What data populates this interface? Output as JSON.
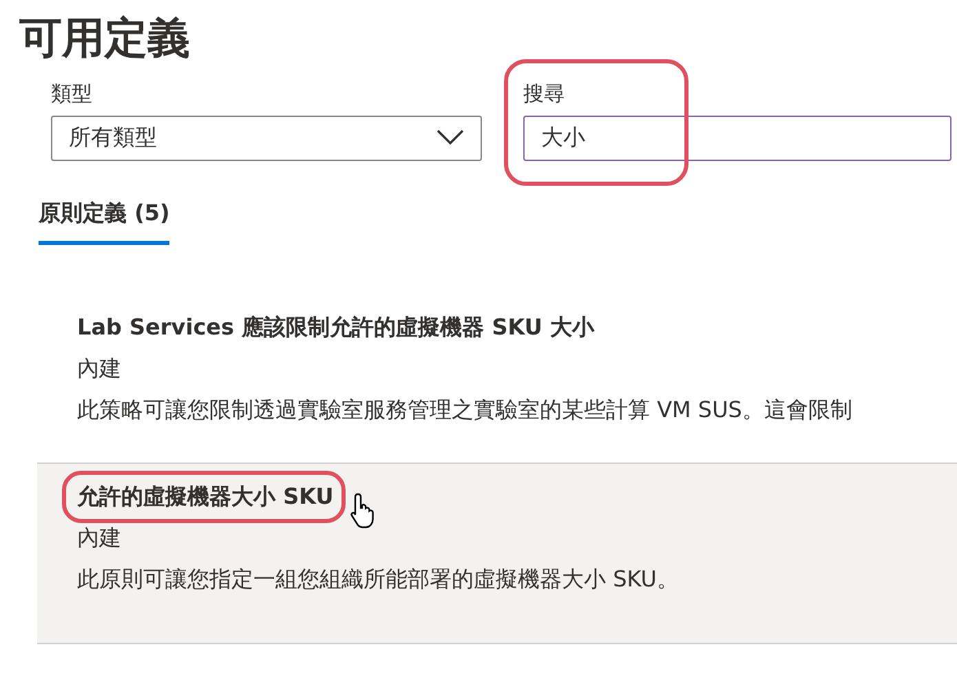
{
  "title": "可用定義",
  "filters": [
    {
      "kind": "dropdown",
      "label": "類型",
      "value": "所有類型",
      "highlighted": false
    },
    {
      "kind": "text",
      "label": "搜尋",
      "value": "大小",
      "highlighted": true
    }
  ],
  "tabs": [
    {
      "label": "原則定義 (5)",
      "selected": true
    }
  ],
  "definitions": [
    {
      "title": "Lab Services 應該限制允許的虛擬機器 SKU 大小",
      "type": "內建",
      "description": "此策略可讓您限制透過實驗室服務管理之實驗室的某些計算 VM SUS。這會限制",
      "hovered": false,
      "highlighted": false
    },
    {
      "title": "允許的虛擬機器大小 SKU",
      "type": "內建",
      "description": "此原則可讓您指定一組您組織所能部署的虛擬機器大小 SKU。",
      "hovered": true,
      "highlighted": true
    }
  ]
}
